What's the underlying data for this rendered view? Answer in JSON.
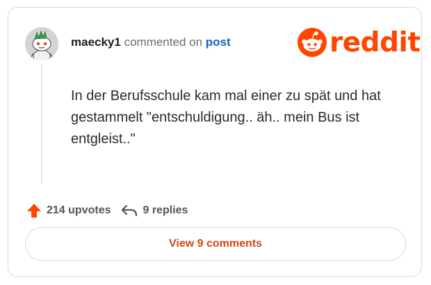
{
  "comment": {
    "username": "maecky1",
    "action_text": "commented on",
    "target_link": "post",
    "body": "In der Berufsschule kam mal einer zu spät und hat gestammelt \"entschuldigung.. äh.. mein Bus ist entgleist..\""
  },
  "brand": {
    "name": "reddit",
    "color": "#ff4500"
  },
  "stats": {
    "upvotes": "214 upvotes",
    "replies": "9 replies"
  },
  "cta": {
    "label": "View 9 comments"
  },
  "icons": [
    "snoo-avatar-icon",
    "reddit-snoo-logo-icon",
    "upvote-arrow-icon",
    "reply-arrow-icon"
  ]
}
